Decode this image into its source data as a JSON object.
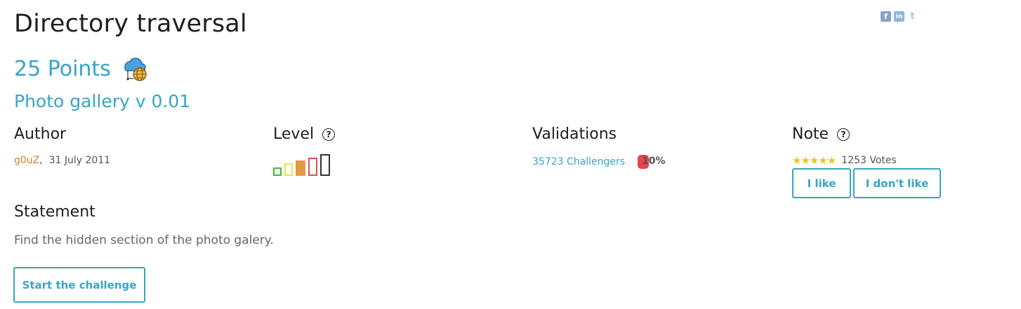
{
  "title": "Directory traversal",
  "points": "25 Points",
  "subtitle": "Photo gallery v 0.01",
  "author": {
    "heading": "Author",
    "name": "g0uZ",
    "date": ",  31 July 2011"
  },
  "level": {
    "heading": "Level",
    "help": "?",
    "current": 3,
    "max": 5
  },
  "validations": {
    "heading": "Validations",
    "challengers": "35723 Challengers",
    "percent": "10%"
  },
  "note": {
    "heading": "Note",
    "help": "?",
    "stars": "★★★★★",
    "votes": "1253 Votes",
    "like": "I like",
    "dislike": "I don't like"
  },
  "statement": {
    "heading": "Statement",
    "text": "Find the hidden section of the photo galery."
  },
  "start_button": "Start the challenge",
  "social": [
    "f",
    "in",
    "t"
  ],
  "colors": {
    "accent": "#36a6c6",
    "author": "#c9822f",
    "level": [
      "#3dbb3d",
      "#f0e04a",
      "#e39a47",
      "#d9534f",
      "#333333"
    ],
    "percent_pill": "#e8434a",
    "stars": "#f0c419"
  },
  "icons": {
    "points": "cloud-globe-icon",
    "social": [
      "facebook-icon",
      "linkedin-icon",
      "twitter-icon"
    ]
  }
}
